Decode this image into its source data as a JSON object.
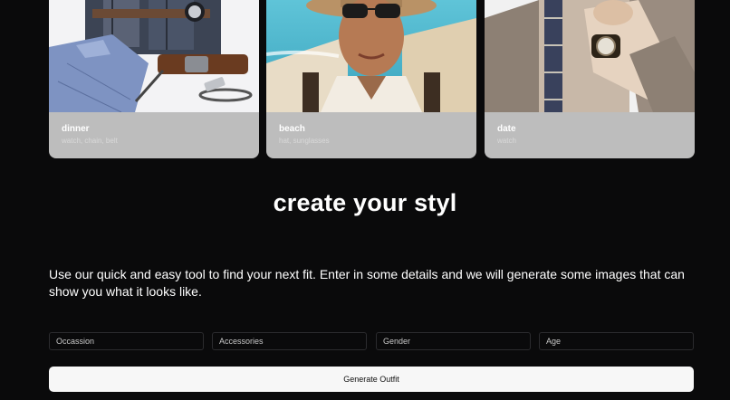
{
  "cards": [
    {
      "title": "dinner",
      "items": "watch, chain, belt",
      "image": "dinner-outfit-illustration"
    },
    {
      "title": "beach",
      "items": "hat, sunglasses",
      "image": "beach-portrait-illustration"
    },
    {
      "title": "date",
      "items": "watch",
      "image": "date-outfit-illustration"
    }
  ],
  "heading": "create your styl",
  "description": "Use our quick and easy tool to find your next fit. Enter in some details and we will generate some images that can show you what it looks like.",
  "form": {
    "occasion_placeholder": "Occassion",
    "accessories_placeholder": "Accessories",
    "gender_placeholder": "Gender",
    "age_placeholder": "Age",
    "submit_label": "Generate Outfit"
  },
  "colors": {
    "background": "#0a0a0b",
    "card_info": "#bdbdbd",
    "button_bg": "#f7f7f7"
  }
}
